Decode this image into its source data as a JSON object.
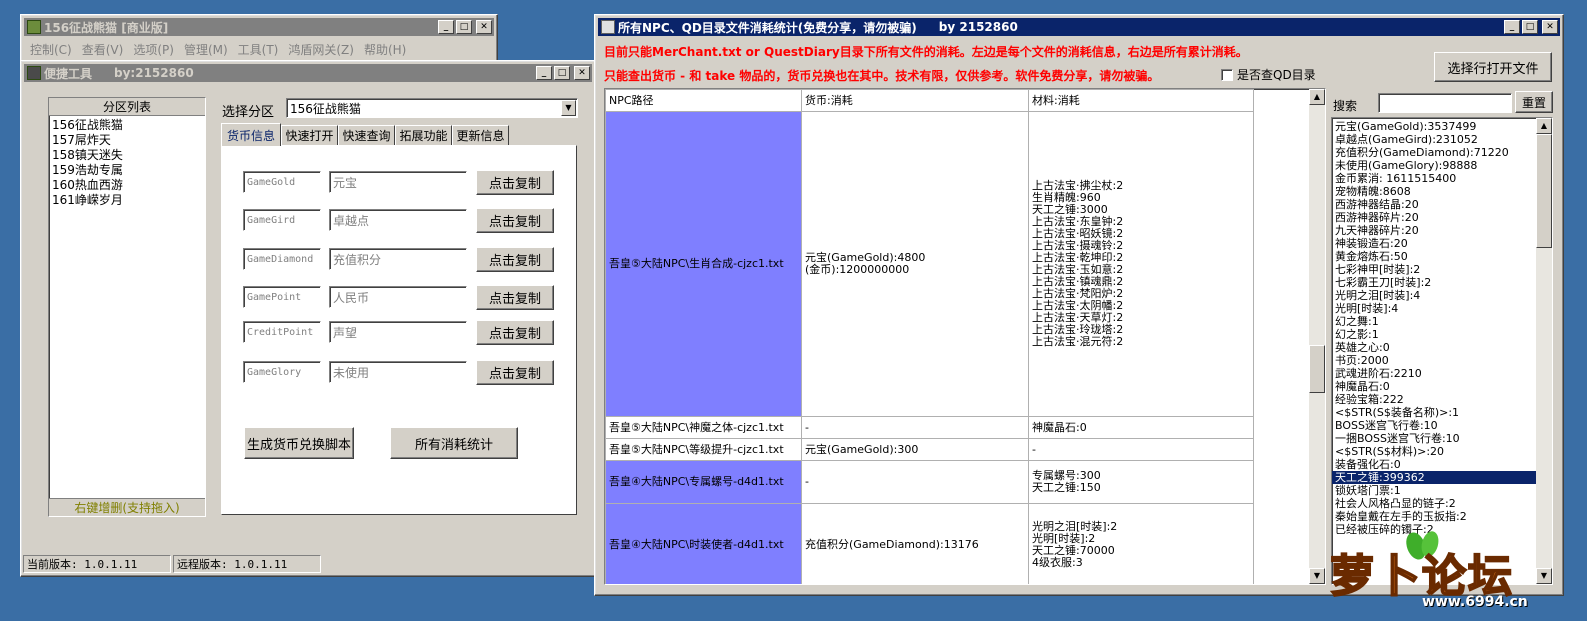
{
  "main_window": {
    "title": "156征战熊猫 [商业版]",
    "menu": [
      "控制(C)",
      "查看(V)",
      "选项(P)",
      "管理(M)",
      "工具(T)",
      "鸿盾网关(Z)",
      "帮助(H)"
    ]
  },
  "tool_window": {
    "title": "便捷工具",
    "by": "by:2152860",
    "partition_list_header": "分区列表",
    "partitions": [
      "156征战熊猫",
      "157屌炸天",
      "158镇天迷失",
      "159浩劫专属",
      "160热血西游",
      "161峥嵘岁月"
    ],
    "list_footer": "右键增删(支持拖入)",
    "select_label": "选择分区",
    "select_value": "156征战熊猫",
    "tabs": [
      "货币信息",
      "快速打开",
      "快速查询",
      "拓展功能",
      "更新信息"
    ],
    "currency_rows": [
      {
        "code": "GameGold",
        "name": "元宝",
        "button": "点击复制"
      },
      {
        "code": "GameGird",
        "name": "卓越点",
        "button": "点击复制"
      },
      {
        "code": "GameDiamond",
        "name": "充值积分",
        "button": "点击复制"
      },
      {
        "code": "GamePoint",
        "name": "人民币",
        "button": "点击复制"
      },
      {
        "code": "CreditPoint",
        "name": "声望",
        "button": "点击复制"
      },
      {
        "code": "GameGlory",
        "name": "未使用",
        "button": "点击复制"
      }
    ],
    "btn_generate": "生成货币兑换脚本",
    "btn_stats": "所有消耗统计",
    "status_current": "当前版本: 1.0.1.11",
    "status_remote": "远程版本: 1.0.1.11"
  },
  "stats_window": {
    "title": "所有NPC、QD目录文件消耗统计(免费分享，请勿被骗)",
    "by": "by 2152860",
    "notice1": "目前只能MerChant.txt or QuestDiary目录下所有文件的消耗。左边是每个文件的消耗信息，右边是所有累计消耗。",
    "notice2": "只能查出货币 - 和 take 物品的，货币兑换也在其中。技术有限，仅供参考。软件免费分享，请勿被骗。",
    "checkbox_label": "是否查QD目录",
    "open_file_button": "选择行打开文件",
    "search_label": "搜索",
    "reset_button": "重置",
    "table_headers": [
      "NPC路径",
      "货币:消耗",
      "材料:消耗"
    ],
    "rows": [
      {
        "npc": "吾皇⑤大陆NPC\\生肖合成-cjzc1.txt",
        "currency": "元宝(GameGold):4800\n(金币):1200000000",
        "material": "上古法宝·拂尘杖:2\n生肖精魄:960\n天工之锤:3000\n上古法宝·东皇钟:2\n上古法宝·昭妖镜:2\n上古法宝·摄魂铃:2\n上古法宝·乾坤印:2\n上古法宝·玉如意:2\n上古法宝·镇魂鼎:2\n上古法宝·梵阳炉:2\n上古法宝·太阴幡:2\n上古法宝·天草灯:2\n上古法宝·玲珑塔:2\n上古法宝·混元符:2",
        "hl": true
      },
      {
        "npc": "吾皇⑤大陆NPC\\神魔之体-cjzc1.txt",
        "currency": "-",
        "material": "神魔晶石:0",
        "hl": false
      },
      {
        "npc": "吾皇⑤大陆NPC\\等级提升-cjzc1.txt",
        "currency": "元宝(GameGold):300",
        "material": "-",
        "hl": false
      },
      {
        "npc": "吾皇④大陆NPC\\专属螺号-d4d1.txt",
        "currency": "-",
        "material": "专属螺号:300\n天工之锤:150",
        "hl": true
      },
      {
        "npc": "吾皇④大陆NPC\\时装使者-d4d1.txt",
        "currency": "充值积分(GameDiamond):13176",
        "material": "光明之泪[时装]:2\n光明[时装]:2\n天工之锤:70000\n4级衣服:3",
        "hl": true
      }
    ],
    "totals": [
      "元宝(GameGold):3537499",
      "卓越点(GameGird):231052",
      "充值积分(GameDiamond):71220",
      "未使用(GameGlory):98888",
      "金币累消: 1611515400",
      "宠物精魄:8608",
      "西游神器结晶:20",
      "西游神器碎片:20",
      "九天神器碎片:20",
      "神装锻造石:20",
      "黄金熔炼石:50",
      "七彩神甲[时装]:2",
      "七彩霸王刀[时装]:2",
      "光明之泪[时装]:4",
      "光明[时装]:4",
      "幻之舞:1",
      "幻之影:1",
      "英雄之心:0",
      "书页:2000",
      "武魂进阶石:2210",
      "神魔晶石:0",
      "经验宝箱:222",
      "<$STR(S$装备名称)>:1",
      "BOSS迷宫飞行卷:10",
      "一捆BOSS迷宫飞行卷:10",
      "<$STR(S$材料)>:20",
      "装备强化石:0",
      "天工之锤:399362",
      "锁妖塔门票:1",
      "社会人风格凸显的链子:2",
      "秦始皇戴在左手的玉扳指:2",
      "已经被压碎的镯子:2"
    ],
    "selected_total_index": 27
  },
  "watermark": {
    "brand": "萝卜论坛",
    "url": "www.6994.cn"
  }
}
